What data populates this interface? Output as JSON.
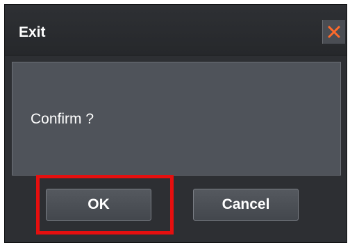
{
  "dialog": {
    "title": "Exit",
    "message": "Confirm ?",
    "buttons": {
      "ok_label": "OK",
      "cancel_label": "Cancel"
    },
    "close_icon": "close-icon"
  },
  "highlight": {
    "target": "ok-button",
    "color": "#e60f0f"
  },
  "colors": {
    "close_icon": "#ff6a2a",
    "dialog_bg": "#2d2f33",
    "content_bg": "#4f535a"
  }
}
